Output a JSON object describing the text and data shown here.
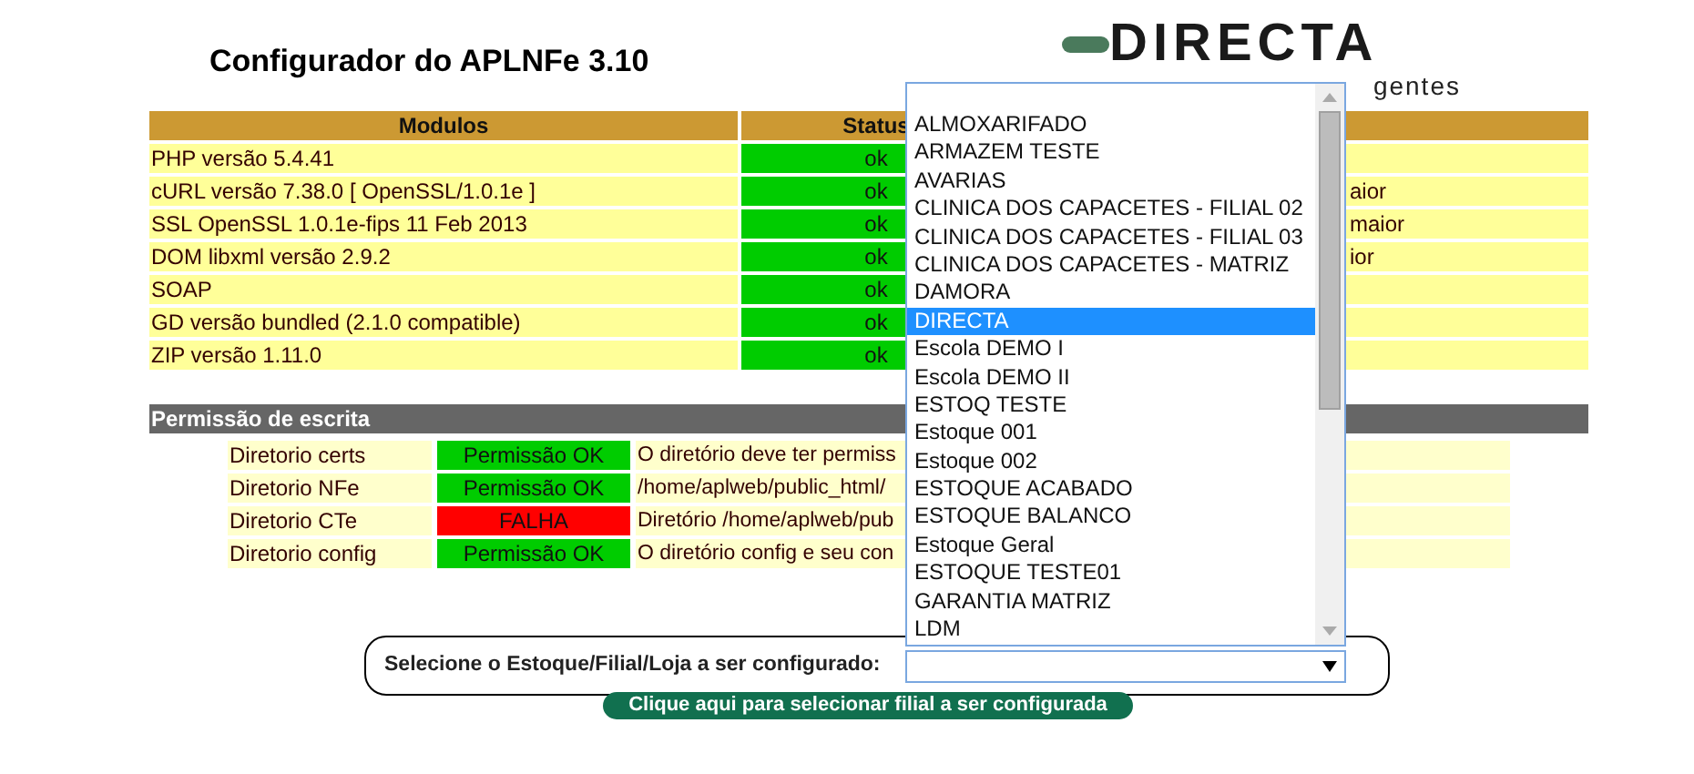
{
  "title": "Configurador do APLNFe 3.10",
  "logo": {
    "name": "DIRECTA",
    "tagline": "gentes"
  },
  "modules": {
    "columns": [
      "Modulos",
      "Status"
    ],
    "rows": [
      {
        "name": "PHP versão 5.4.41",
        "status": "ok",
        "passed": true
      },
      {
        "name": "cURL versão 7.38.0 [ OpenSSL/1.0.1e ]",
        "status": "ok",
        "passed": true,
        "note": "aior"
      },
      {
        "name": "SSL OpenSSL 1.0.1e-fips 11 Feb 2013",
        "status": "ok",
        "passed": true,
        "note": "maior"
      },
      {
        "name": "DOM libxml versão 2.9.2",
        "status": "ok",
        "passed": true,
        "note": "ior"
      },
      {
        "name": "SOAP",
        "status": "ok",
        "passed": true
      },
      {
        "name": "GD versão bundled (2.1.0 compatible)",
        "status": "ok",
        "passed": true
      },
      {
        "name": "ZIP versão 1.11.0",
        "status": "ok",
        "passed": true
      }
    ]
  },
  "permissions": {
    "title": "Permissão de escrita",
    "rows": [
      {
        "name": "Diretorio certs",
        "status": "Permissão OK",
        "passed": true,
        "message": "O diretório deve ter permiss"
      },
      {
        "name": "Diretorio NFe",
        "status": "Permissão OK",
        "passed": true,
        "message": "/home/aplweb/public_html/"
      },
      {
        "name": "Diretorio CTe",
        "status": "FALHA",
        "passed": false,
        "message": "Diretório /home/aplweb/pub"
      },
      {
        "name": "Diretorio config",
        "status": "Permissão OK",
        "passed": true,
        "message": "O diretório config e seu con"
      }
    ]
  },
  "selector": {
    "label": "Selecione o Estoque/Filial/Loja a ser configurado:",
    "options": [
      {
        "label": "ALMOXARIFADO",
        "selected": false
      },
      {
        "label": "ARMAZEM TESTE",
        "selected": false
      },
      {
        "label": "AVARIAS",
        "selected": false
      },
      {
        "label": "CLINICA DOS CAPACETES - FILIAL 02",
        "selected": false
      },
      {
        "label": "CLINICA DOS CAPACETES - FILIAL 03",
        "selected": false
      },
      {
        "label": "CLINICA DOS CAPACETES - MATRIZ",
        "selected": false
      },
      {
        "label": "DAMORA",
        "selected": false
      },
      {
        "label": "DIRECTA",
        "selected": true
      },
      {
        "label": "Escola DEMO I",
        "selected": false
      },
      {
        "label": "Escola DEMO II",
        "selected": false
      },
      {
        "label": "ESTOQ TESTE",
        "selected": false
      },
      {
        "label": "Estoque 001",
        "selected": false
      },
      {
        "label": "Estoque 002",
        "selected": false
      },
      {
        "label": "ESTOQUE ACABADO",
        "selected": false
      },
      {
        "label": "ESTOQUE BALANCO",
        "selected": false
      },
      {
        "label": "Estoque Geral",
        "selected": false
      },
      {
        "label": "ESTOQUE TESTE01",
        "selected": false
      },
      {
        "label": "GARANTIA MATRIZ",
        "selected": false
      },
      {
        "label": "LDM",
        "selected": false
      }
    ],
    "button": "Clique aqui para selecionar filial a ser configurada"
  }
}
